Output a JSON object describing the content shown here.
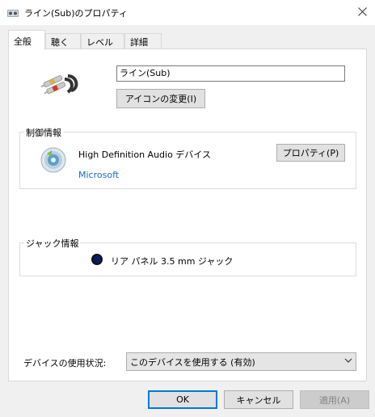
{
  "window": {
    "title": "ライン(Sub)のプロパティ",
    "icons": {
      "app": "speaker-icon",
      "close": "close-icon"
    }
  },
  "tabs": [
    {
      "label": "全般",
      "active": true
    },
    {
      "label": "聴く"
    },
    {
      "label": "レベル"
    },
    {
      "label": "詳細"
    }
  ],
  "general": {
    "device_name_value": "ライン(Sub)",
    "change_icon_button": "アイコンの変更(I)",
    "device_icon": "rca-cable-icon"
  },
  "controller": {
    "group_label": "制御情報",
    "name": "High Definition Audio デバイス",
    "vendor_link": "Microsoft",
    "properties_button": "プロパティ(P)",
    "icon": "speaker-cd-icon"
  },
  "jack": {
    "group_label": "ジャック情報",
    "description": "リア パネル 3.5 mm ジャック",
    "jack_color": "#0a1a5e"
  },
  "usage": {
    "label": "デバイスの使用状況:",
    "selected": "このデバイスを使用する (有効)"
  },
  "footer": {
    "ok": "OK",
    "cancel": "キャンセル",
    "apply": "適用(A)"
  },
  "colors": {
    "accent": "#0078d7",
    "link": "#1a6ac0"
  }
}
